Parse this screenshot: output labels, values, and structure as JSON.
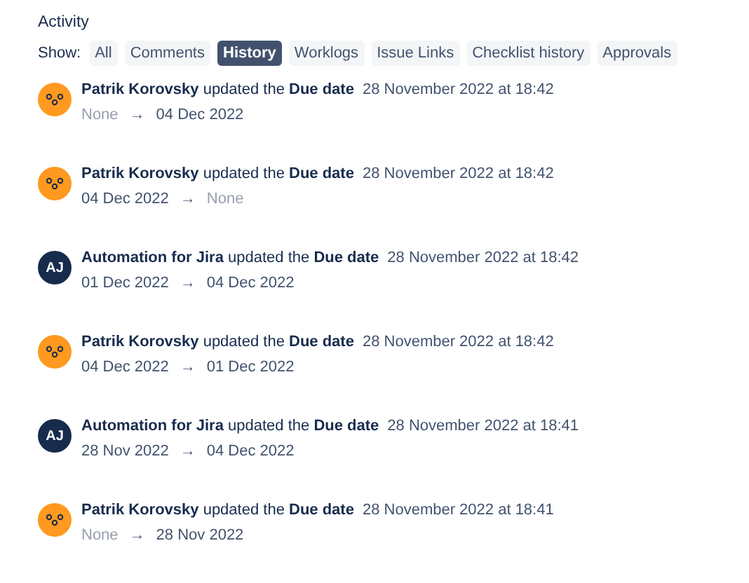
{
  "heading": "Activity",
  "filter": {
    "label": "Show:",
    "tabs": [
      {
        "label": "All",
        "selected": false
      },
      {
        "label": "Comments",
        "selected": false
      },
      {
        "label": "History",
        "selected": true
      },
      {
        "label": "Worklogs",
        "selected": false
      },
      {
        "label": "Issue Links",
        "selected": false
      },
      {
        "label": "Checklist history",
        "selected": false
      },
      {
        "label": "Approvals",
        "selected": false
      }
    ]
  },
  "entries": [
    {
      "avatar": {
        "kind": "dots"
      },
      "summary": "**Patrik Korovsky** updated the **Due date**",
      "time": "28 November 2022 at 18:42",
      "from": {
        "text": "None",
        "empty": true
      },
      "arrow": "→",
      "to": {
        "text": "04 Dec 2022",
        "empty": false
      }
    },
    {
      "avatar": {
        "kind": "dots"
      },
      "summary": "**Patrik Korovsky** updated the **Due date**",
      "time": "28 November 2022 at 18:42",
      "from": {
        "text": "04 Dec 2022",
        "empty": false
      },
      "arrow": "→",
      "to": {
        "text": "None",
        "empty": true
      }
    },
    {
      "avatar": {
        "kind": "initials",
        "initials": "AJ"
      },
      "summary": "**Automation for Jira** updated the **Due date**",
      "time": "28 November 2022 at 18:42",
      "from": {
        "text": "01 Dec 2022",
        "empty": false
      },
      "arrow": "→",
      "to": {
        "text": "04 Dec 2022",
        "empty": false
      }
    },
    {
      "avatar": {
        "kind": "dots"
      },
      "summary": "**Patrik Korovsky** updated the **Due date**",
      "time": "28 November 2022 at 18:42",
      "from": {
        "text": "04 Dec 2022",
        "empty": false
      },
      "arrow": "→",
      "to": {
        "text": "01 Dec 2022",
        "empty": false
      }
    },
    {
      "avatar": {
        "kind": "initials",
        "initials": "AJ"
      },
      "summary": "**Automation for Jira** updated the **Due date**",
      "time": "28 November 2022 at 18:41",
      "from": {
        "text": "28 Nov 2022",
        "empty": false
      },
      "arrow": "→",
      "to": {
        "text": "04 Dec 2022",
        "empty": false
      }
    },
    {
      "avatar": {
        "kind": "dots"
      },
      "summary": "**Patrik Korovsky** updated the **Due date**",
      "time": "28 November 2022 at 18:41",
      "from": {
        "text": "None",
        "empty": true
      },
      "arrow": "→",
      "to": {
        "text": "28 Nov 2022",
        "empty": false
      }
    }
  ]
}
